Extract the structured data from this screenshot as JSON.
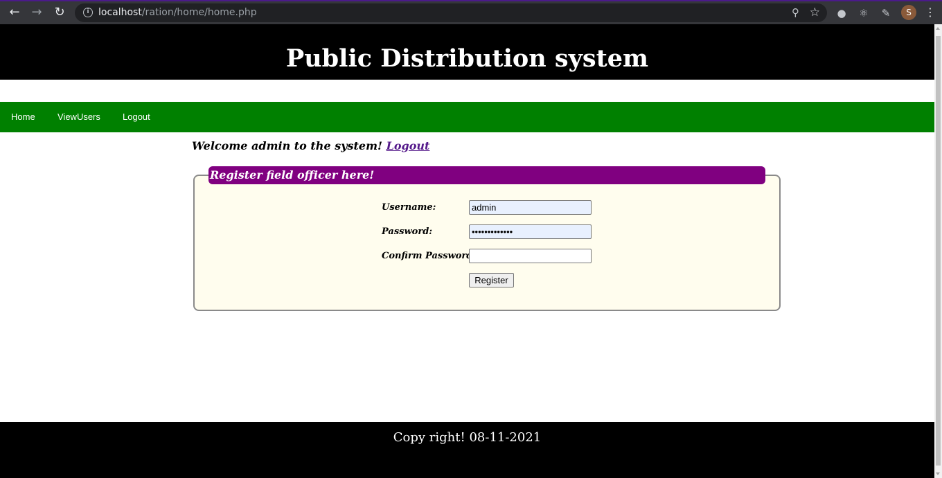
{
  "browser": {
    "url_host": "localhost",
    "url_path": "/ration/home/home.php",
    "profile_initial": "S"
  },
  "page": {
    "title": "Public Distribution system",
    "nav": {
      "home": "Home",
      "view_users": "ViewUsers",
      "logout": "Logout"
    },
    "welcome_text": "Welcome admin to the system!",
    "welcome_logout": "Logout",
    "form": {
      "legend": "Register field officer here!",
      "username_label": "Username:",
      "username_value": "admin",
      "password_label": "Password:",
      "password_value": "•••••••••••••",
      "confirm_label": "Confirm Password:",
      "confirm_value": "",
      "register_label": "Register"
    },
    "footer": "Copy right! 08-11-2021"
  },
  "colors": {
    "header_bg": "#000000",
    "nav_bg": "#008000",
    "legend_bg": "#800080",
    "form_bg": "#fffdee"
  }
}
